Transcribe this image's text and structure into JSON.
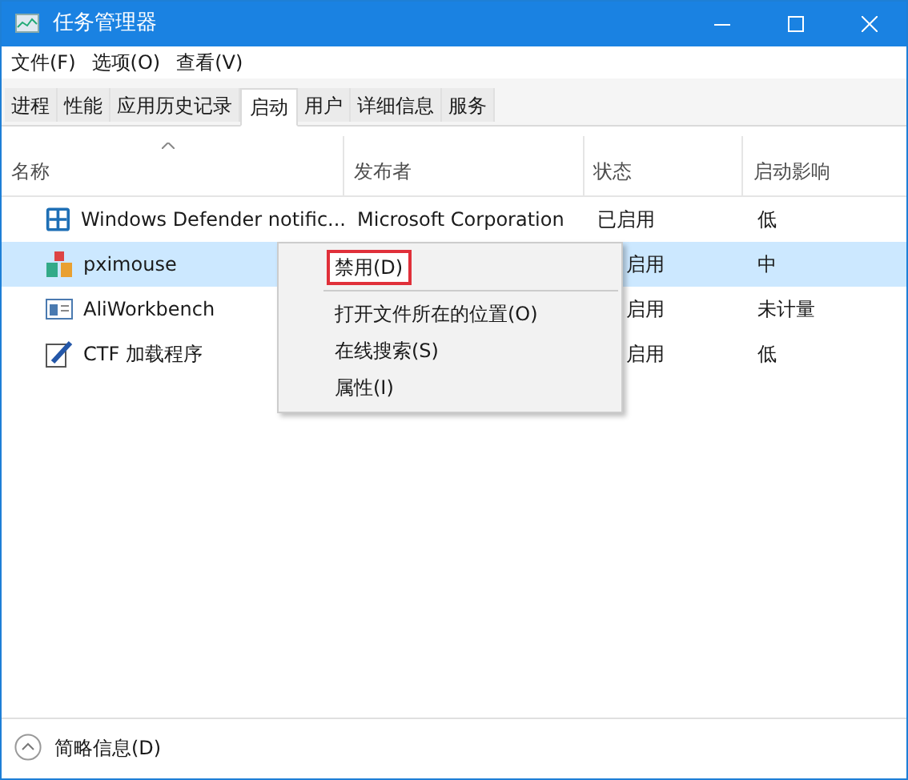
{
  "window": {
    "title": "任务管理器"
  },
  "menu_bar": [
    "文件(F)",
    "选项(O)",
    "查看(V)"
  ],
  "tabs": [
    {
      "label": "进程",
      "selected": false
    },
    {
      "label": "性能",
      "selected": false
    },
    {
      "label": "应用历史记录",
      "selected": false
    },
    {
      "label": "启动",
      "selected": true
    },
    {
      "label": "用户",
      "selected": false
    },
    {
      "label": "详细信息",
      "selected": false
    },
    {
      "label": "服务",
      "selected": false
    }
  ],
  "table": {
    "columns": [
      {
        "label": "名称",
        "sorted": true
      },
      {
        "label": "发布者",
        "sorted": false
      },
      {
        "label": "状态",
        "sorted": false
      },
      {
        "label": "启动影响",
        "sorted": false
      }
    ],
    "rows": [
      {
        "kind": "shield",
        "name": "Windows Defender notific...",
        "publisher": "Microsoft Corporation",
        "status": "已启用",
        "impact": "低",
        "selected": false
      },
      {
        "kind": "app",
        "name": "pximouse",
        "status": "启用",
        "impact": "中",
        "selected": true
      },
      {
        "kind": "window",
        "name": "AliWorkbench",
        "status": "启用",
        "impact": "未计量",
        "selected": false
      },
      {
        "kind": "pen",
        "name": "CTF 加载程序",
        "status": "启用",
        "impact": "低",
        "selected": false
      }
    ]
  },
  "context_menu": [
    {
      "kind": "item",
      "label": "禁用(D)",
      "highlighted": true
    },
    {
      "kind": "separator"
    },
    {
      "kind": "item",
      "label": "打开文件所在的位置(O)",
      "highlighted": false
    },
    {
      "kind": "item",
      "label": "在线搜索(S)",
      "highlighted": false
    },
    {
      "kind": "item",
      "label": "属性(I)",
      "highlighted": false
    }
  ],
  "footer": {
    "label": "简略信息(D)"
  }
}
